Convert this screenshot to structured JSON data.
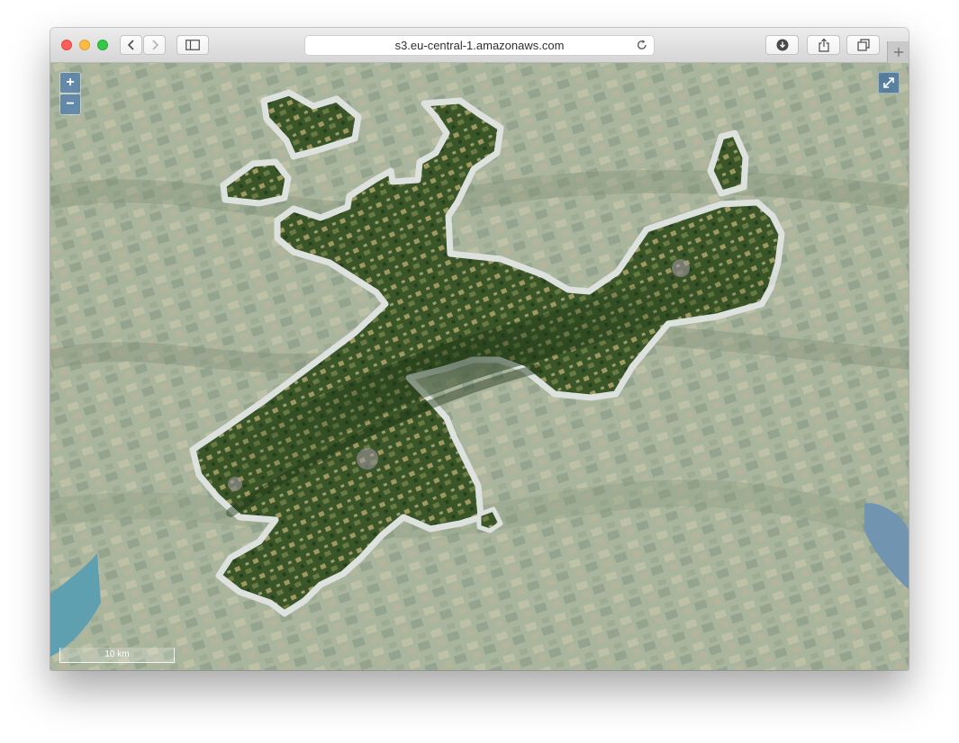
{
  "browser": {
    "url": "s3.eu-central-1.amazonaws.com"
  },
  "toolbar_icons": [
    "back-icon",
    "forward-icon",
    "sidebar-icon",
    "reload-icon",
    "download-icon",
    "share-icon",
    "tabs-icon",
    "plus-icon"
  ],
  "map": {
    "zoom_in_label": "+",
    "zoom_out_label": "−",
    "scale_label": "10 km",
    "colors": {
      "background_imagery": "#a6b09a",
      "region_fill": "#3e5a2a",
      "region_outline": "#dfe3e0",
      "control_fill": "#3c6ea0",
      "lake": "#6aa0b4"
    }
  }
}
